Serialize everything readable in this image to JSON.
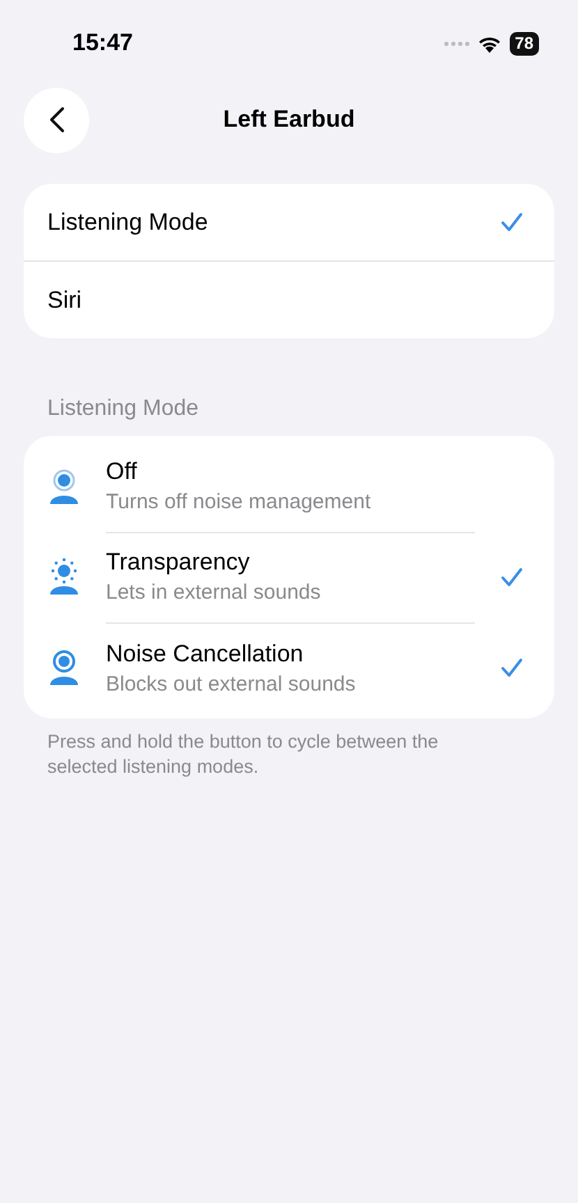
{
  "status_bar": {
    "time": "15:47",
    "battery": "78"
  },
  "nav": {
    "title": "Left Earbud"
  },
  "action_options": [
    {
      "label": "Listening Mode",
      "selected": true
    },
    {
      "label": "Siri",
      "selected": false
    }
  ],
  "modes_section": {
    "header": "Listening Mode",
    "modes": [
      {
        "kind": "off",
        "title": "Off",
        "subtitle": "Turns off noise management",
        "checked": false
      },
      {
        "kind": "transparency",
        "title": "Transparency",
        "subtitle": "Lets in external sounds",
        "checked": true
      },
      {
        "kind": "noise",
        "title": "Noise Cancellation",
        "subtitle": "Blocks out external sounds",
        "checked": true
      }
    ],
    "footer": "Press and hold the button to cycle between the selected listening modes."
  }
}
